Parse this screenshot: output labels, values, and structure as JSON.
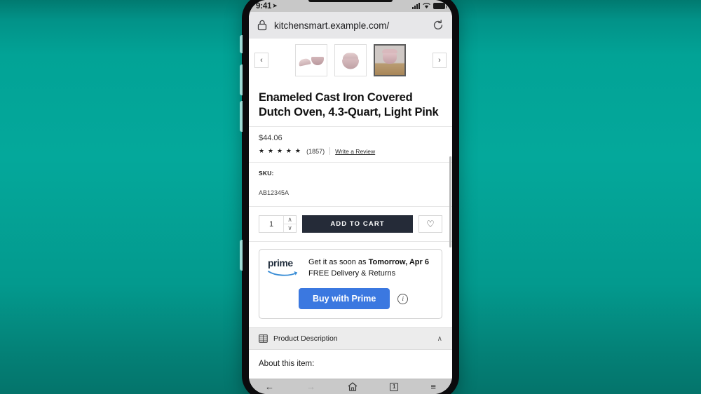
{
  "background": {
    "color_top": "#017a70",
    "color_mid": "#04a89b",
    "color_bottom": "#04746b"
  },
  "status_bar": {
    "time": "9:41",
    "location_icon": "location-arrow-icon",
    "signal_icon": "signal-bars-icon",
    "wifi_icon": "wifi-icon",
    "battery_icon": "battery-full-icon"
  },
  "browser": {
    "lock_icon": "lock-icon",
    "url": "kitchensmart.example.com/",
    "reload_icon": "reload-icon"
  },
  "carousel": {
    "prev_label": "‹",
    "next_label": "›",
    "thumbnails": [
      {
        "name": "dutch-oven-open-lid",
        "selected": false
      },
      {
        "name": "dutch-oven-closed",
        "selected": false
      },
      {
        "name": "dutch-oven-on-board",
        "selected": true
      }
    ]
  },
  "product": {
    "title": "Enameled Cast Iron Covered Dutch Oven, 4.3-Quart, Light Pink",
    "price": "$44.06",
    "stars": "★ ★ ★ ★ ★",
    "review_count": "(1857)",
    "write_review": "Write a Review",
    "sku_label": "SKU:",
    "sku_value": "AB12345A"
  },
  "cart": {
    "quantity": "1",
    "stepper_up": "∧",
    "stepper_down": "∨",
    "add_to_cart_label": "ADD TO CART",
    "wishlist_icon": "heart-icon",
    "wishlist_glyph": "♡"
  },
  "prime": {
    "wordmark": "prime",
    "swoosh_icon": "prime-swoosh-icon",
    "delivery_prefix": "Get it as soon as ",
    "delivery_date": "Tomorrow, Apr 6",
    "delivery_line2": "FREE Delivery & Returns",
    "buy_button_label": "Buy with Prime",
    "info_icon": "info-circle-icon",
    "info_glyph": "i",
    "button_color": "#3b78e0"
  },
  "description": {
    "icon": "table-grid-icon",
    "label": "Product Description",
    "chevron": "∧",
    "about_heading": "About this item:"
  },
  "nav": {
    "back": "←",
    "forward": "→",
    "home": "⌂",
    "tabs_count": "1",
    "menu": "≡"
  }
}
